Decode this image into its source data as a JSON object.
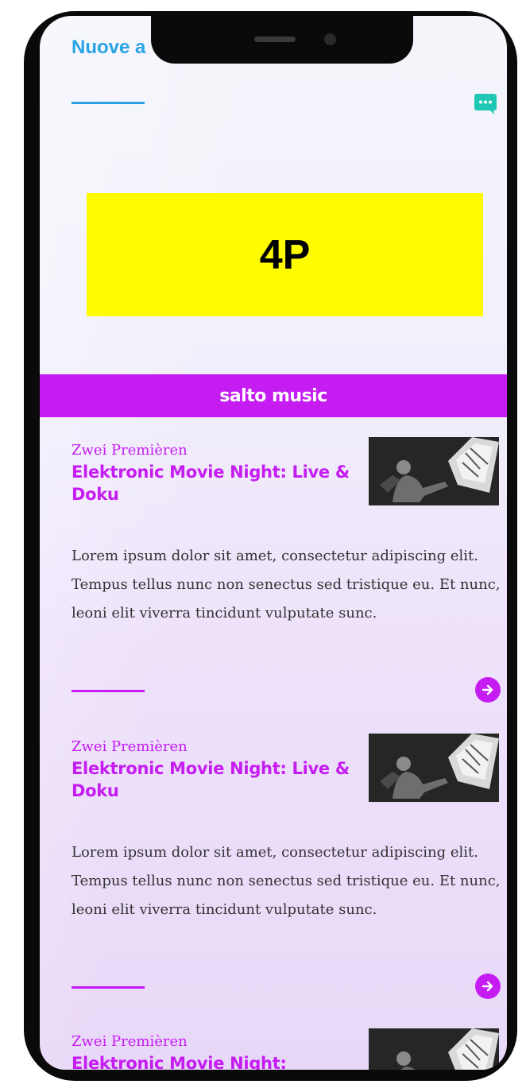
{
  "header": {
    "faint_title": "",
    "title": "Nuove a",
    "chat_icon": "chat-bubble-icon"
  },
  "ad": {
    "label": "4P",
    "color": "#fffb00"
  },
  "section": {
    "title": "salto music",
    "color": "#c51cf2"
  },
  "articles": [
    {
      "kicker": "Zwei Premièren",
      "headline": "Elektronic Movie Night: Live & Doku",
      "excerpt": "Lorem ipsum dolor sit amet, consectetur adipiscing elit. Tempus tellus nunc non senectus sed tristique eu. Et nunc, leoni elit viverra tincidunt vulputate sunc.",
      "image": "concert-photo"
    },
    {
      "kicker": "Zwei Premièren",
      "headline": "Elektronic Movie Night: Live & Doku",
      "excerpt": "Lorem ipsum dolor sit amet, consectetur adipiscing elit. Tempus tellus nunc non senectus sed tristique eu. Et nunc, leoni elit viverra tincidunt vulputate sunc.",
      "image": "concert-photo"
    },
    {
      "kicker": "Zwei Premièren",
      "headline": "Elektronic Movie Night:",
      "image": "concert-photo"
    }
  ],
  "colors": {
    "accent_blue": "#2aa3e6",
    "accent_purple": "#c51cf2",
    "chat_icon": "#1fc7b4"
  }
}
